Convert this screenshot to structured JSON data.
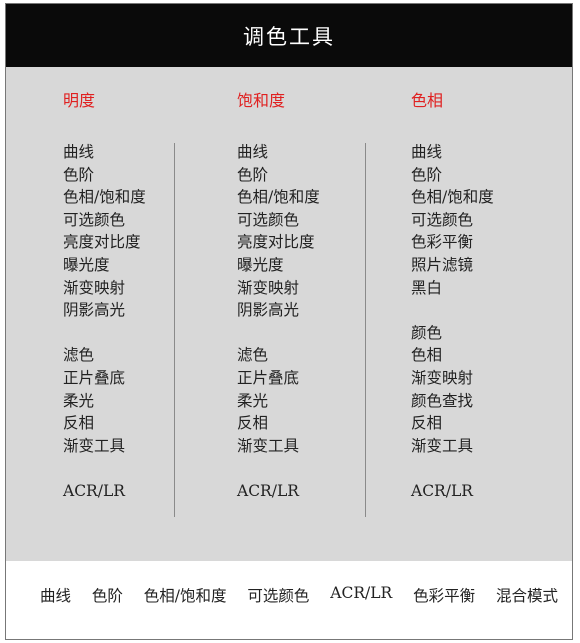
{
  "header": {
    "title": "调色工具"
  },
  "columns": [
    {
      "title": "明度",
      "items": [
        "曲线",
        "色阶",
        "色相/饱和度",
        "可选颜色",
        "亮度对比度",
        "曝光度",
        "渐变映射",
        "阴影高光",
        "",
        "滤色",
        "正片叠底",
        "柔光",
        "反相",
        "渐变工具",
        "",
        "ACR/LR"
      ]
    },
    {
      "title": "饱和度",
      "items": [
        "曲线",
        "色阶",
        "色相/饱和度",
        "可选颜色",
        "亮度对比度",
        "曝光度",
        "渐变映射",
        "阴影高光",
        "",
        "滤色",
        "正片叠底",
        "柔光",
        "反相",
        "渐变工具",
        "",
        "ACR/LR"
      ]
    },
    {
      "title": "色相",
      "items": [
        "曲线",
        "色阶",
        "色相/饱和度",
        "可选颜色",
        "色彩平衡",
        "照片滤镜",
        "黑白",
        "",
        "颜色",
        "色相",
        "渐变映射",
        "颜色查找",
        "反相",
        "渐变工具",
        "",
        "ACR/LR"
      ]
    }
  ],
  "footer": {
    "items": [
      "曲线",
      "色阶",
      "色相/饱和度",
      "可选颜色",
      "ACR/LR",
      "色彩平衡",
      "混合模式"
    ]
  },
  "colors": {
    "header_bg": "#0a0a0a",
    "panel_bg": "#d8d8d8",
    "title_red": "#e02020"
  }
}
